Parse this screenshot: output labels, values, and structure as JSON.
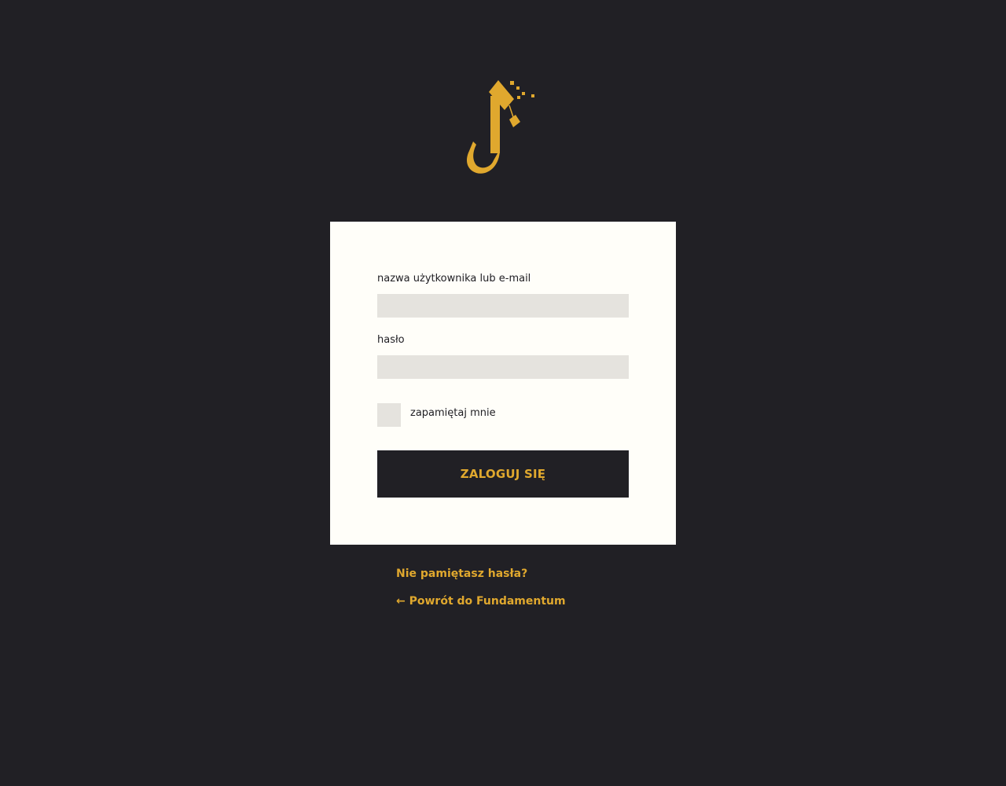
{
  "colors": {
    "background": "#212025",
    "card": "#FFFEF9",
    "input": "#E5E3DE",
    "accent": "#E0A82E",
    "text": "#212025"
  },
  "logo": {
    "icon": "fundamentum-logo"
  },
  "login_form": {
    "username_label": "nazwa użytkownika lub e-mail",
    "username_value": "",
    "password_label": "hasło",
    "password_value": "",
    "remember_label": "zapamiętaj mnie",
    "remember_checked": false,
    "submit_label": "ZALOGUJ SIĘ"
  },
  "links": {
    "lost_password": "Nie pamiętasz hasła?",
    "back_to_site": "← Powrót do Fundamentum"
  }
}
